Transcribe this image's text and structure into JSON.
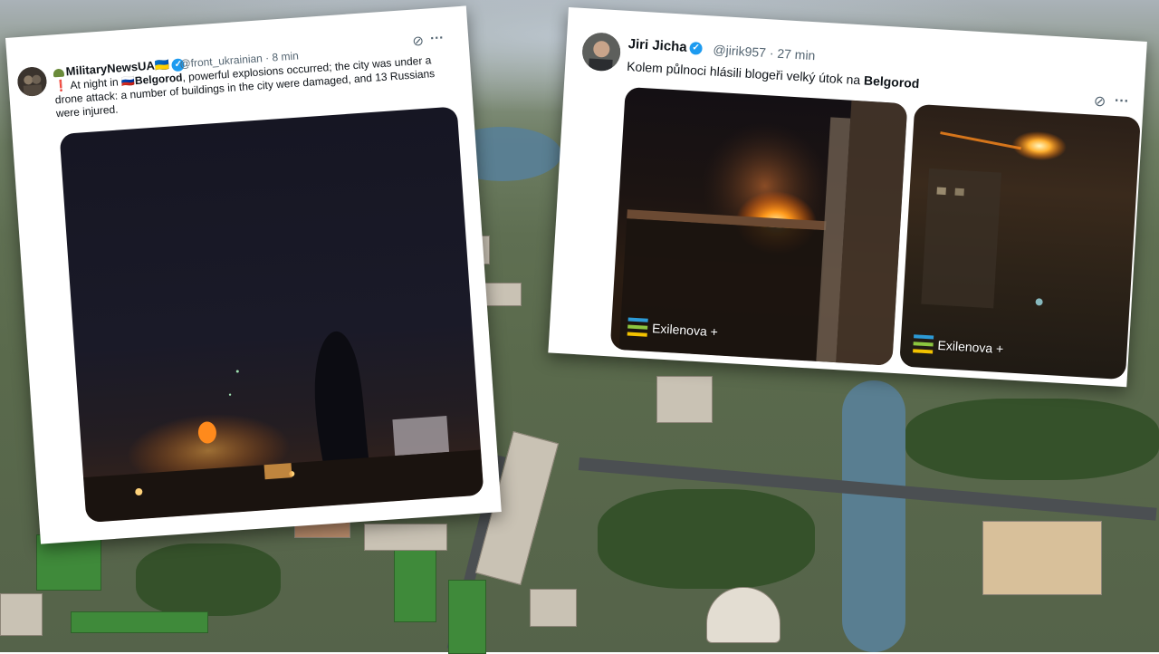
{
  "tweets": [
    {
      "display_name": "MilitaryNewsUA",
      "name_flag_emoji": "🇺🇦",
      "handle": "@front_ukrainian",
      "time": "· 8 min",
      "text_prefix": "❗ At night in ",
      "text_flag_emoji": "🇷🇺",
      "text_bold": "Belgorod",
      "text_rest": ", powerful explosions occurred; the city was under a drone attack: a number of buildings in the city were damaged, and 13 Russians were injured.",
      "verified": true,
      "icons": [
        "grok-icon",
        "more-icon"
      ]
    },
    {
      "display_name": "Jiri Jicha",
      "handle": "@jirik957",
      "time": "· 27 min",
      "text_prefix": "Kolem půlnoci hlásili blogeři velký útok na ",
      "text_bold": "Belgorod",
      "verified": true,
      "icons": [
        "grok-icon",
        "more-icon"
      ],
      "media_watermark": "Exilenova +"
    }
  ],
  "colors": {
    "verified_blue": "#1d9bf0",
    "text_primary": "#0f1419",
    "text_secondary": "#536471",
    "fire_orange": "#ff8a1c"
  }
}
